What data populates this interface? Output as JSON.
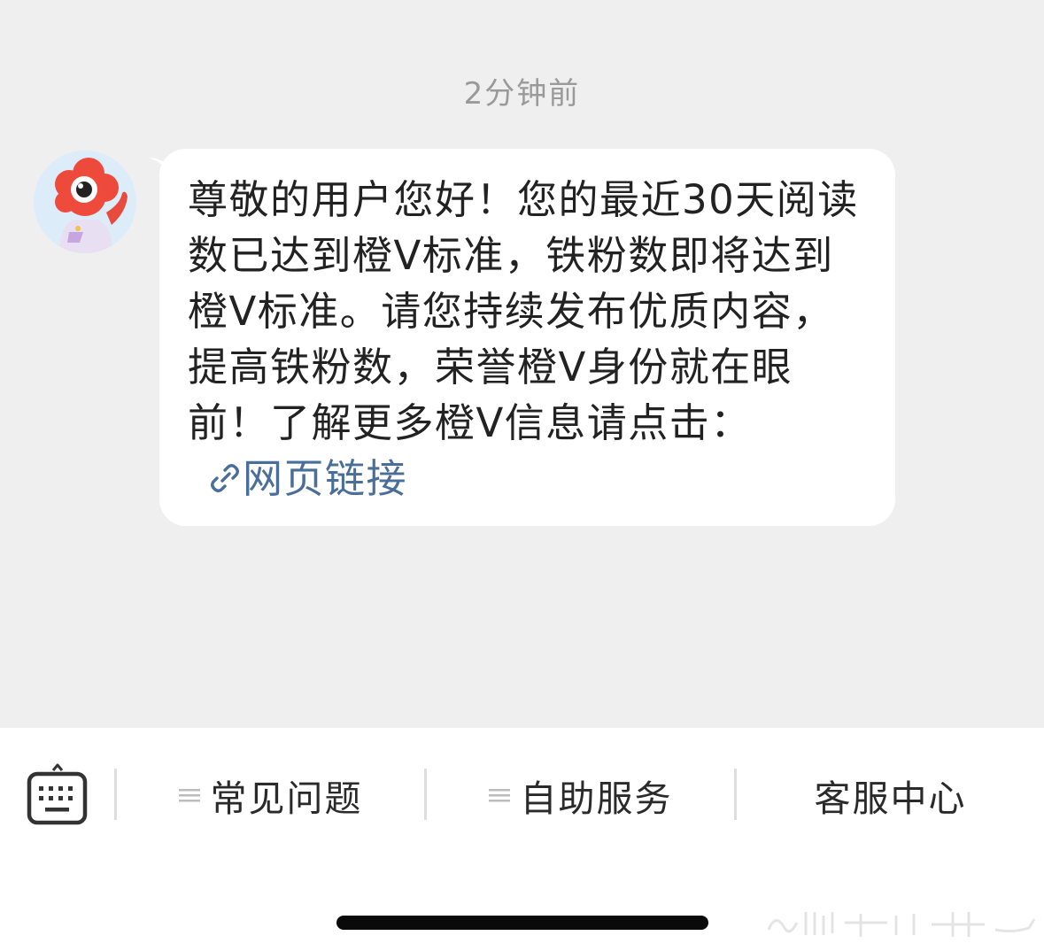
{
  "chat": {
    "timestamp": "2分钟前",
    "message": {
      "text": "尊敬的用户您好！您的最近30天阅读数已达到橙V标准，铁粉数即将达到橙V标准。请您持续发布优质内容，提高铁粉数，荣誉橙V身份就在眼前！了解更多橙V信息请点击：",
      "link_label": "网页链接",
      "link_icon": "link-icon"
    },
    "avatar_icon": "mascot-avatar"
  },
  "bottom_bar": {
    "keyboard_icon": "keyboard-icon",
    "menu": [
      {
        "label": "常见问题",
        "icon": "menu-lines-icon"
      },
      {
        "label": "自助服务",
        "icon": "menu-lines-icon"
      },
      {
        "label": "客服中心"
      }
    ]
  },
  "colors": {
    "chat_background": "#efefef",
    "bubble": "#ffffff",
    "link": "#4a6e9a",
    "text": "#222222",
    "timestamp": "#9a9a9a"
  }
}
